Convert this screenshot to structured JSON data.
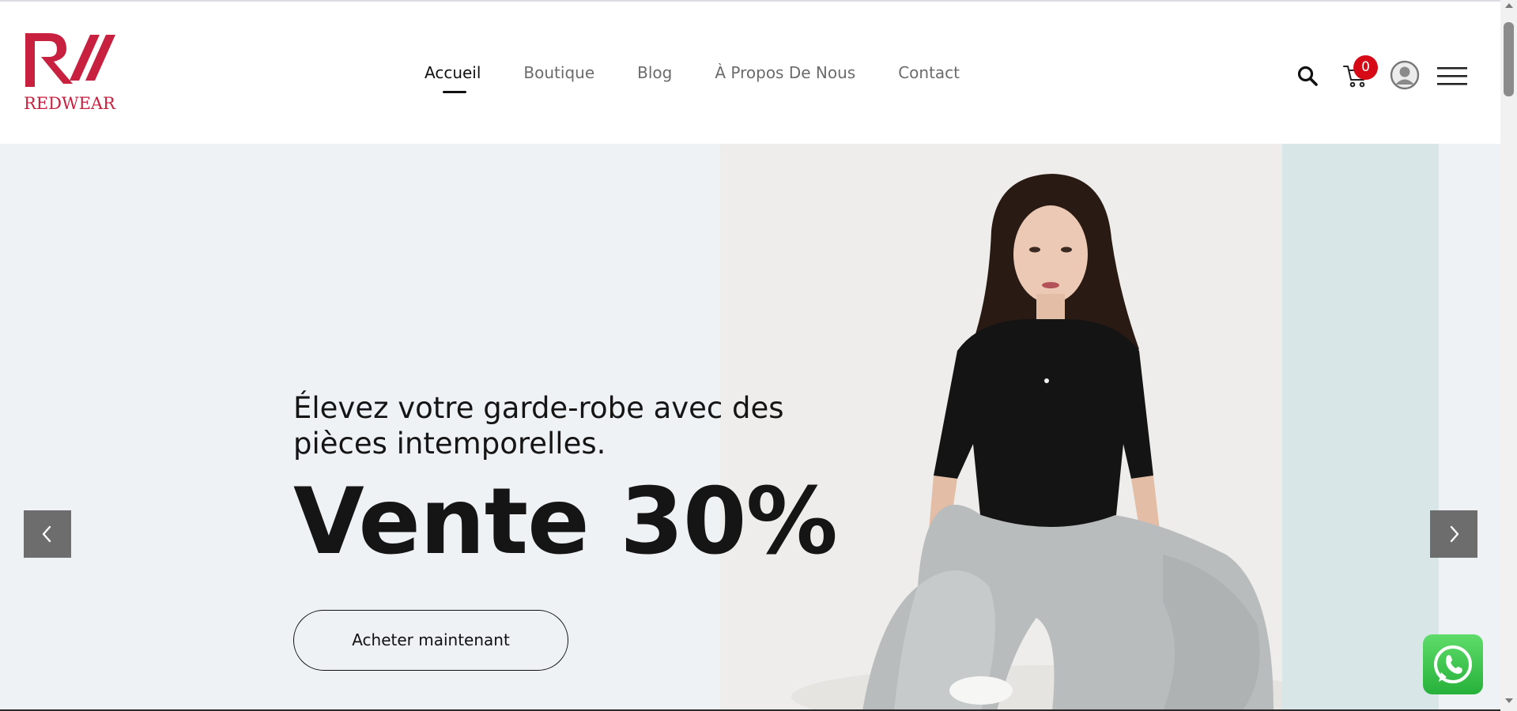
{
  "brand": {
    "logo_text": "REDWEAR",
    "color": "#c8203f"
  },
  "nav": {
    "items": [
      {
        "label": "Accueil",
        "active": true
      },
      {
        "label": "Boutique",
        "active": false
      },
      {
        "label": "Blog",
        "active": false
      },
      {
        "label": "À Propos De Nous",
        "active": false
      },
      {
        "label": "Contact",
        "active": false
      }
    ]
  },
  "header_icons": {
    "search": "search-icon",
    "cart": "cart-icon",
    "cart_count": "0",
    "cart_badge_color": "#d60a16",
    "account": "account-icon",
    "menu": "hamburger-menu-icon"
  },
  "hero": {
    "subtitle": "Élevez votre garde-robe avec des pièces intemporelles.",
    "title": "Vente 30%",
    "cta_label": "Acheter maintenant",
    "background_color": "#eef2f5",
    "accent_stripe_color": "#d8e6e8",
    "prev_icon": "chevron-left-icon",
    "next_icon": "chevron-right-icon"
  },
  "floating": {
    "whatsapp_icon": "whatsapp-icon",
    "whatsapp_color": "#26b13b"
  }
}
